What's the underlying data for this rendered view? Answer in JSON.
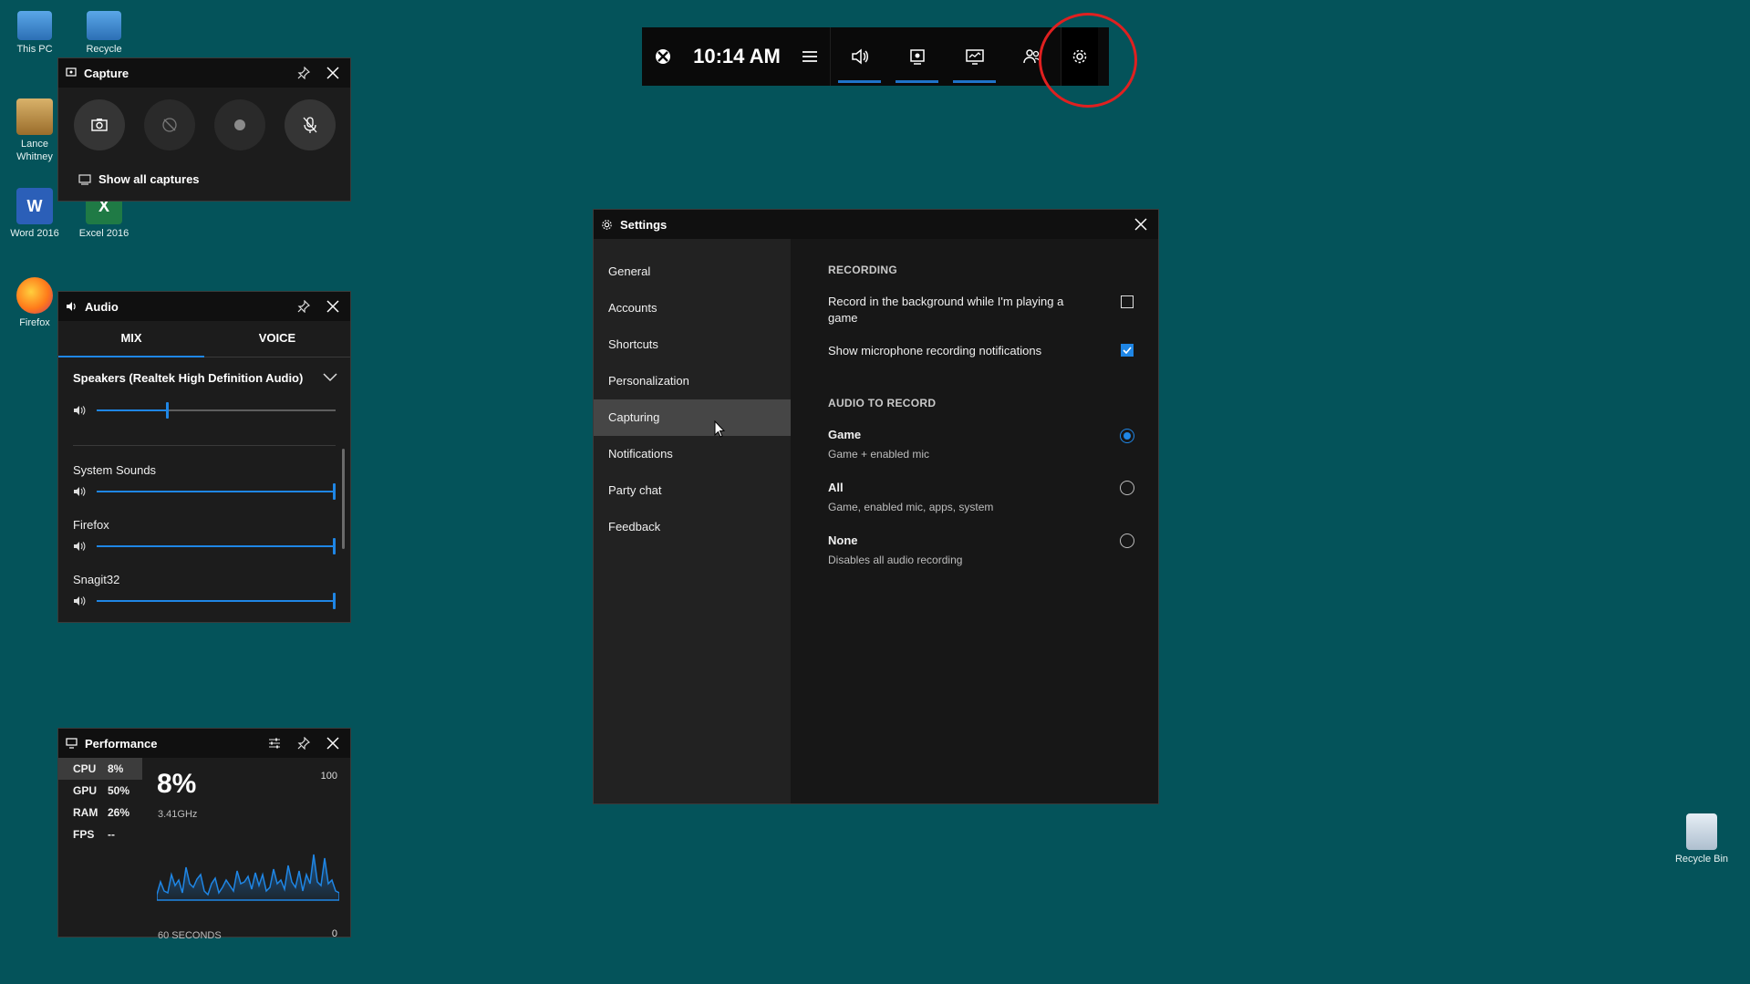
{
  "desktop": {
    "icons": [
      {
        "label": "This PC"
      },
      {
        "label": "Recycle"
      },
      {
        "label": "Lance Whitney"
      },
      {
        "label": "Word 2016"
      },
      {
        "label": "Excel 2016"
      },
      {
        "label": "Firefox"
      },
      {
        "label": "Recycle Bin"
      }
    ]
  },
  "xbox_bar": {
    "time": "10:14 AM",
    "highlight_color": "#e02020"
  },
  "capture": {
    "title": "Capture",
    "show_all": "Show all captures"
  },
  "audio": {
    "title": "Audio",
    "tabs": [
      "MIX",
      "VOICE"
    ],
    "device": "Speakers (Realtek High Definition Audio)",
    "master_level": 0.3,
    "apps": [
      {
        "name": "System Sounds",
        "level": 1.0
      },
      {
        "name": "Firefox",
        "level": 1.0
      },
      {
        "name": "Snagit32",
        "level": 1.0
      }
    ]
  },
  "performance": {
    "title": "Performance",
    "stats": [
      {
        "key": "CPU",
        "value": "8%"
      },
      {
        "key": "GPU",
        "value": "50%"
      },
      {
        "key": "RAM",
        "value": "26%"
      },
      {
        "key": "FPS",
        "value": "--"
      }
    ],
    "big_value": "8%",
    "freq": "3.41GHz",
    "max": "100",
    "min": "0",
    "window": "60 SECONDS",
    "accent": "#1f86e5"
  },
  "settings": {
    "title": "Settings",
    "nav": [
      "General",
      "Accounts",
      "Shortcuts",
      "Personalization",
      "Capturing",
      "Notifications",
      "Party chat",
      "Feedback"
    ],
    "selected": "Capturing",
    "recording_title": "RECORDING",
    "record_bg": "Record in the background while I'm playing a game",
    "record_bg_checked": false,
    "show_mic": "Show microphone recording notifications",
    "show_mic_checked": true,
    "audio_title": "AUDIO TO RECORD",
    "options": [
      {
        "label": "Game",
        "sub": "Game + enabled mic",
        "selected": true
      },
      {
        "label": "All",
        "sub": "Game, enabled mic, apps, system",
        "selected": false
      },
      {
        "label": "None",
        "sub": "Disables all audio recording",
        "selected": false
      }
    ]
  }
}
